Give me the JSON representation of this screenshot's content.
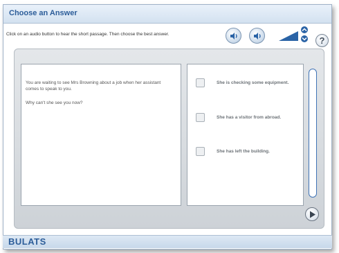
{
  "window": {
    "title": "Choose an Answer"
  },
  "instruction": "Click on an audio button to hear the short passage. Then choose the best answer.",
  "controls": {
    "audio_button_1_icon": "speaker-icon",
    "audio_button_2_icon": "speaker-icon",
    "volume_icon": "volume-bars-icon",
    "help_label": "?"
  },
  "passage": {
    "text": "You are waiting to see Mrs Browning about a job when her assistant comes to speak to you.",
    "question": "Why can't she see you now?"
  },
  "options": [
    {
      "label": "She is checking some equipment."
    },
    {
      "label": "She has a visitor from abroad."
    },
    {
      "label": "She has left the building."
    }
  ],
  "footer": {
    "brand": "BULATS"
  },
  "colors": {
    "accent": "#2a63a6",
    "title": "#2c5d99"
  }
}
